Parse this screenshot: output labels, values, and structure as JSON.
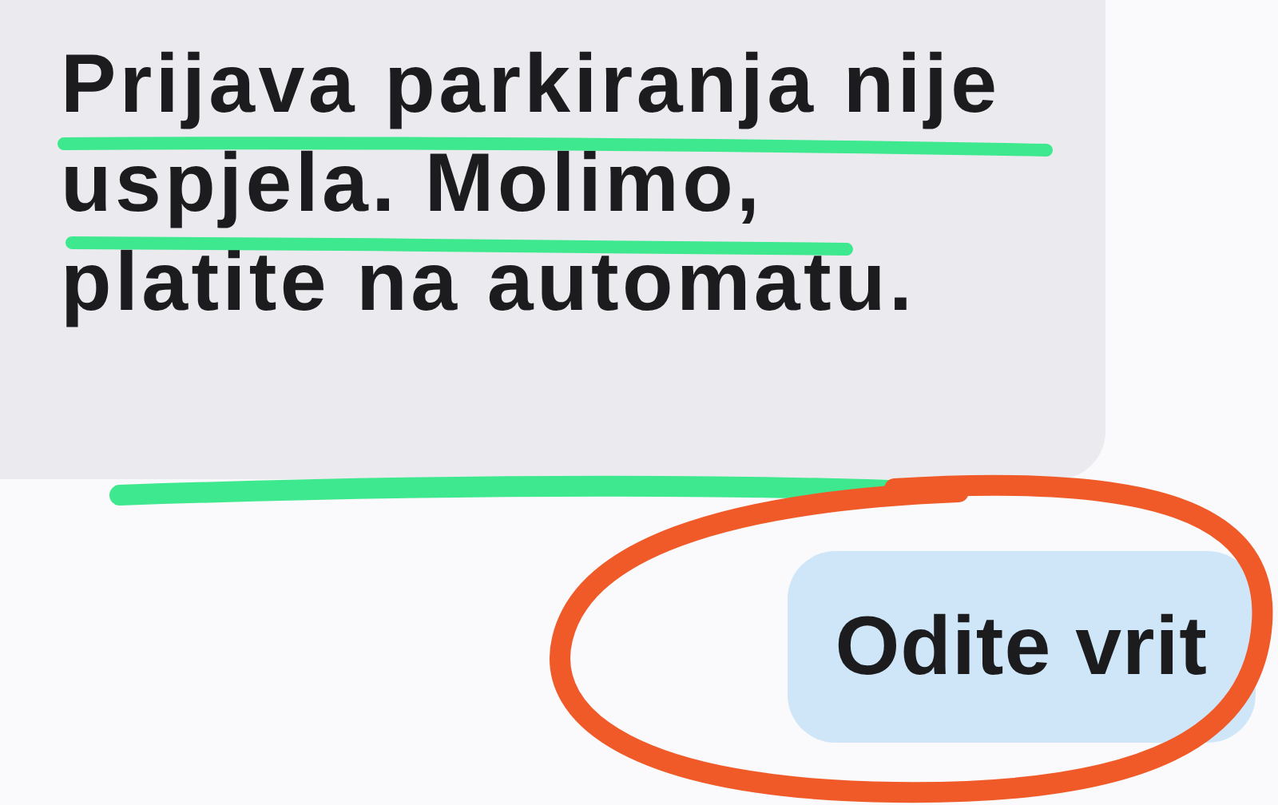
{
  "messages": [
    {
      "kind": "incoming",
      "text": "Prijava parkiranja nije\nuspjela. Molimo,\nplatite na automatu."
    },
    {
      "kind": "outgoing",
      "text": "Odite vrit"
    }
  ],
  "annotations": [
    {
      "kind": "underline",
      "color": "#3ee88e"
    },
    {
      "kind": "underline",
      "color": "#3ee88e"
    },
    {
      "kind": "underline",
      "color": "#3ee88e"
    },
    {
      "kind": "circle",
      "color": "#f05a28"
    }
  ]
}
